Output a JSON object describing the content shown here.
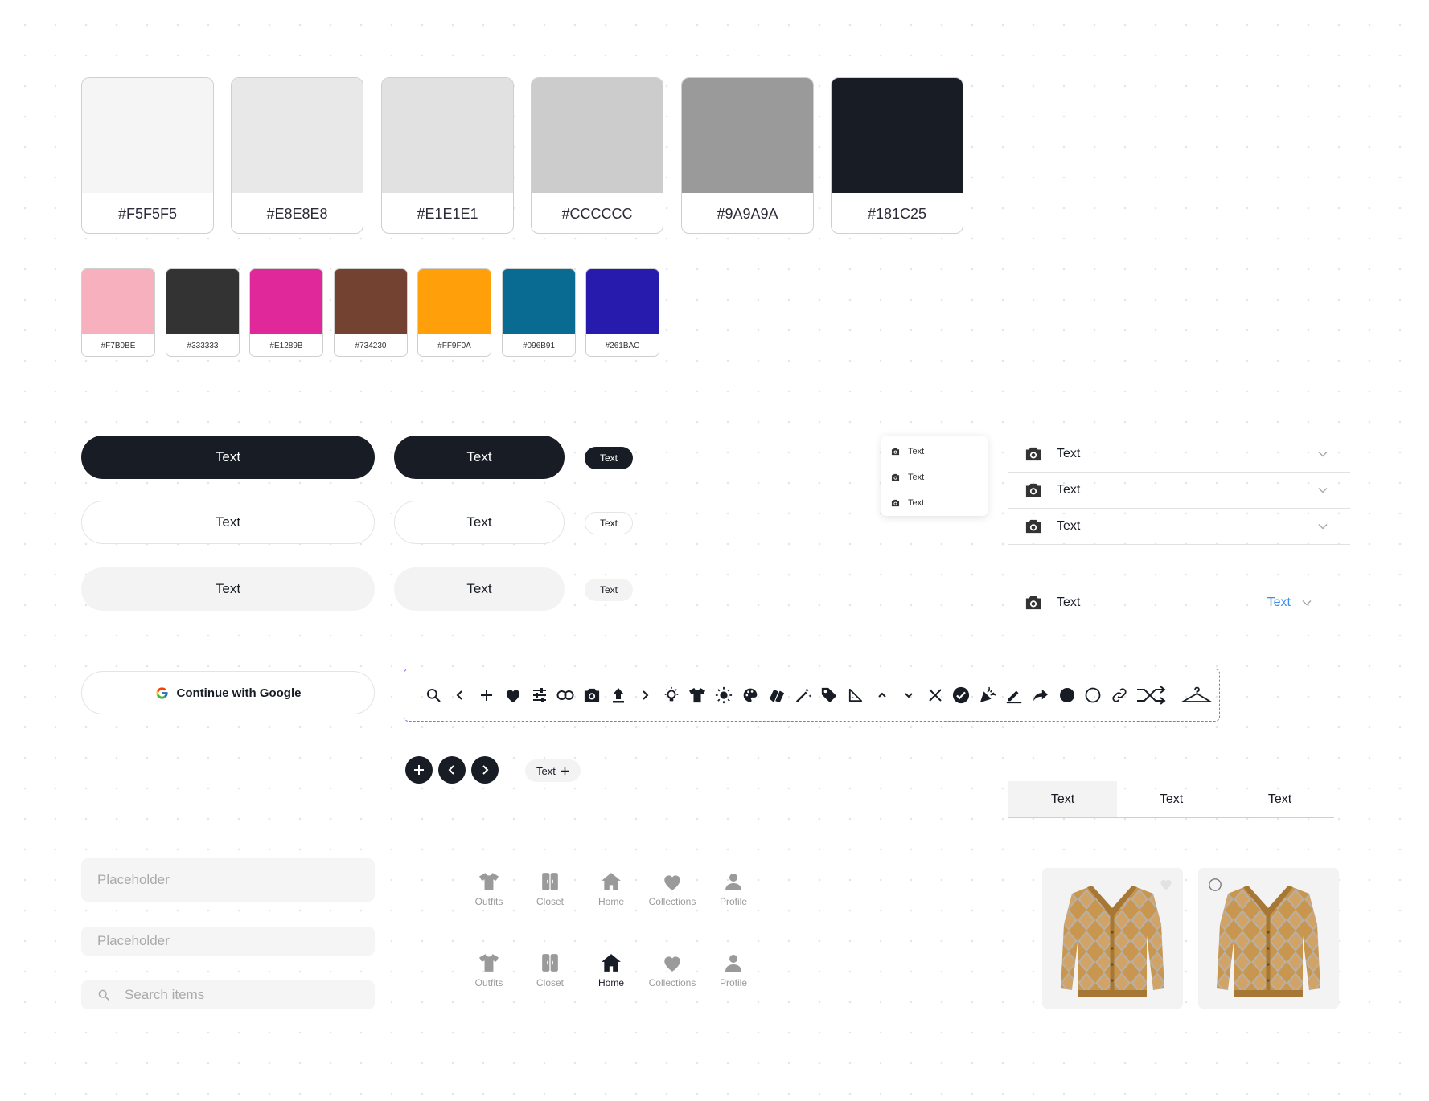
{
  "palette_neutrals": [
    {
      "code": "#F5F5F5",
      "color": "#F5F5F5"
    },
    {
      "code": "#E8E8E8",
      "color": "#E8E8E8"
    },
    {
      "code": "#E1E1E1",
      "color": "#E1E1E1"
    },
    {
      "code": "#CCCCCC",
      "color": "#CCCCCC"
    },
    {
      "code": "#9A9A9A",
      "color": "#9A9A9A"
    },
    {
      "code": "#181C25",
      "color": "#181C25"
    }
  ],
  "palette_accents": [
    {
      "code": "#F7B0BE",
      "color": "#F7B0BE"
    },
    {
      "code": "#333333",
      "color": "#333333"
    },
    {
      "code": "#E1289B",
      "color": "#E1289B"
    },
    {
      "code": "#734230",
      "color": "#734230"
    },
    {
      "code": "#FF9F0A",
      "color": "#FF9F0A"
    },
    {
      "code": "#096B91",
      "color": "#096B91"
    },
    {
      "code": "#261BAC",
      "color": "#261BAC"
    }
  ],
  "buttons": {
    "primary_large": "Text",
    "primary_medium": "Text",
    "primary_small": "Text",
    "outline_large": "Text",
    "outline_medium": "Text",
    "outline_small": "Text",
    "soft_large": "Text",
    "soft_medium": "Text",
    "soft_small": "Text"
  },
  "dropdown_menu": {
    "items": [
      "Text",
      "Text",
      "Text"
    ]
  },
  "list_rows": {
    "items": [
      "Text",
      "Text",
      "Text"
    ],
    "value_row": {
      "label": "Text",
      "value": "Text"
    }
  },
  "google_button": {
    "label": "Continue with Google"
  },
  "icon_strip": {
    "icons": [
      "search-icon",
      "chevron-left-icon",
      "plus-icon",
      "heart-icon",
      "sliders-icon",
      "link-icon",
      "camera-icon",
      "upload-icon",
      "chevron-right-icon",
      "lightbulb-icon",
      "tshirt-icon",
      "sun-icon",
      "palette-icon",
      "swatches-icon",
      "magic-wand-icon",
      "tag-icon",
      "ruler-icon",
      "chevron-up-icon",
      "chevron-down-icon",
      "close-icon",
      "check-circle-icon",
      "party-popper-icon",
      "pen-icon",
      "share-arrow-icon",
      "filled-circle-icon",
      "empty-circle-icon",
      "link-outline-icon",
      "shuffle-icon",
      "hanger-icon"
    ]
  },
  "chip": {
    "label": "Text"
  },
  "tabs": {
    "items": [
      "Text",
      "Text",
      "Text"
    ],
    "active_index": 0
  },
  "inputs": {
    "large_placeholder": "Placeholder",
    "medium_placeholder": "Placeholder",
    "search_placeholder": "Search items"
  },
  "nav_default": {
    "items": [
      "Outfits",
      "Closet",
      "Home",
      "Collections",
      "Profile"
    ]
  },
  "nav_home_active": {
    "items": [
      "Outfits",
      "Closet",
      "Home",
      "Collections",
      "Profile"
    ],
    "active_index": 2
  },
  "colors": {
    "primary": "#181C25",
    "link": "#3b8ee6",
    "focus_outline": "#a45df0"
  }
}
